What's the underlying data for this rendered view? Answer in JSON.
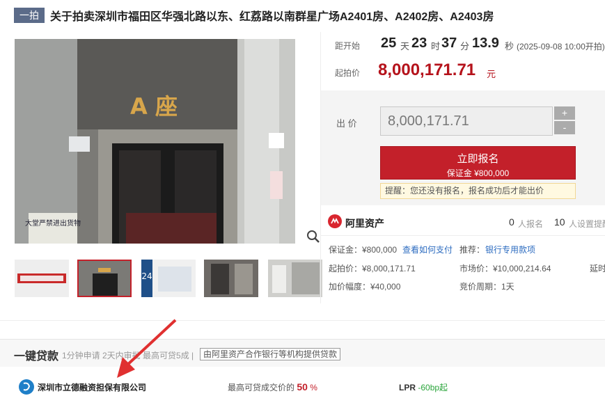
{
  "title": {
    "badge": "一拍",
    "text": "关于拍卖深圳市福田区华强北路以东、红荔路以南群星广场A2401房、A2402房、A2403房"
  },
  "photo": {
    "sign_text": "A 座",
    "banner_text": "大堂严禁进出货物"
  },
  "countdown": {
    "label": "距开始",
    "days": "25",
    "days_unit": "天",
    "hours": "23",
    "hours_unit": "时",
    "minutes": "37",
    "minutes_unit": "分",
    "seconds": "13.9",
    "seconds_unit": "秒",
    "start_time": "(2025-09-08 10:00开拍)"
  },
  "start_price": {
    "label": "起拍价",
    "value": "8,000,171.71",
    "unit": "元"
  },
  "bid": {
    "label": "出 价",
    "input_value": "8,000,171.71",
    "plus": "+",
    "minus": "-",
    "signup_label": "立即报名",
    "deposit_label": "保证金 ¥800,000",
    "tip": "提醒：您还没有报名，报名成功后才能出价"
  },
  "platform": {
    "name": "阿里资产",
    "signup_count": "0",
    "signup_label": "人报名",
    "reminder_count": "10",
    "reminder_label": "人设置提醒"
  },
  "info": {
    "deposit": "保证金：¥800,000",
    "deposit_link": "查看如何支付",
    "recommend_label": "推荐：",
    "recommend_link": "银行专用款项",
    "start_price": "起拍价：¥8,000,171.71",
    "market_price": "市场价：¥10,000,214.64",
    "delay": "延时",
    "increment": "加价幅度：¥40,000",
    "cycle": "竞价周期：1天"
  },
  "loan": {
    "title": "一键贷款",
    "subtitle": "1分钟申请 2天内审批 最高可贷5成 |",
    "tag": "由阿里资产合作银行等机构提供贷款",
    "lender": "深圳市立德融资担保有限公司",
    "max_label": "最高可贷成交价的",
    "max_value": "50",
    "max_unit": "%",
    "lpr_label": "LPR",
    "lpr_value": "-60bp起"
  },
  "colors": {
    "accent": "#c3202a",
    "price": "#b5121b",
    "link": "#2d6cc0"
  }
}
